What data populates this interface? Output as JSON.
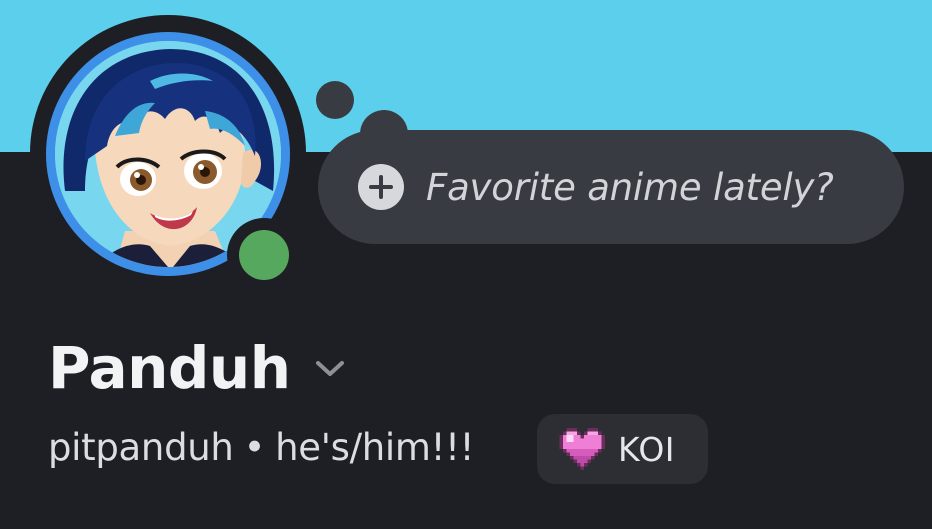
{
  "profile": {
    "display_name": "Panduh",
    "username": "pitpanduh",
    "separator": "•",
    "pronouns": "he's/him!!!",
    "status": "online",
    "avatar_icon": "anime-avatar-icon",
    "status_color": "#57a85f"
  },
  "thought_bubble": {
    "prompt": "Favorite anime lately?",
    "icon": "plus-circle-icon"
  },
  "badge": {
    "label": "KOI",
    "icon": "pixel-heart-icon"
  },
  "colors": {
    "banner": "#5ccfec",
    "background": "#1e1f24",
    "bubble": "#393b42",
    "avatar_ring": "#3d8fe8"
  }
}
